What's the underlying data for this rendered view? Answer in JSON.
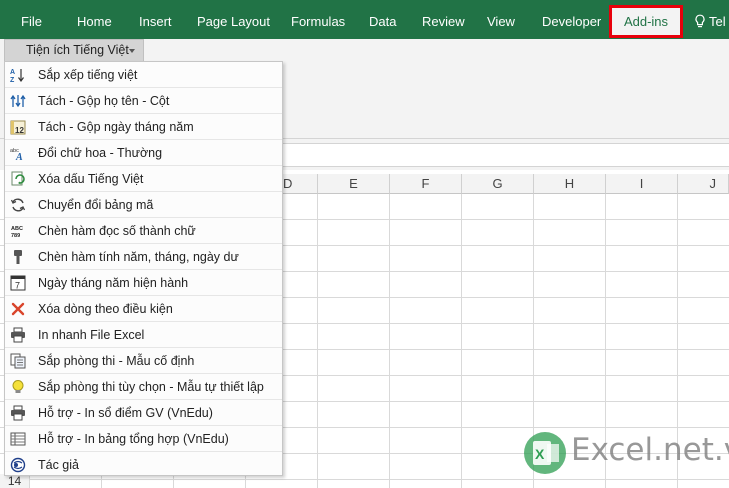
{
  "ribbon_tabs": [
    {
      "label": "File"
    },
    {
      "label": "Home"
    },
    {
      "label": "Insert"
    },
    {
      "label": "Page Layout"
    },
    {
      "label": "Formulas"
    },
    {
      "label": "Data"
    },
    {
      "label": "Review"
    },
    {
      "label": "View"
    },
    {
      "label": "Developer"
    }
  ],
  "active_tab": {
    "label": "Add-ins"
  },
  "tell_me": {
    "label": "Tel",
    "icon": "lightbulb-icon"
  },
  "addin_dropdown": {
    "label": "Tiện ích Tiếng Việt"
  },
  "columns": [
    "D",
    "E",
    "F",
    "G",
    "H",
    "I",
    "J"
  ],
  "row_label": "14",
  "menu_items": [
    {
      "label": "Sắp xếp tiếng việt",
      "icon": "sort-az-icon"
    },
    {
      "label": "Tách - Gộp họ tên - Cột",
      "icon": "split-merge-icon"
    },
    {
      "label": "Tách - Gộp ngày tháng năm",
      "icon": "calendar-split-icon"
    },
    {
      "label": "Đổi chữ hoa - Thường",
      "icon": "change-case-icon"
    },
    {
      "label": "Xóa dấu Tiếng Việt",
      "icon": "remove-accent-icon"
    },
    {
      "label": "Chuyển đổi bảng mã",
      "icon": "convert-icon"
    },
    {
      "label": "Chèn hàm đọc số thành chữ",
      "icon": "number-to-text-icon"
    },
    {
      "label": "Chèn hàm tính năm, tháng, ngày dư",
      "icon": "pin-icon"
    },
    {
      "label": "Ngày tháng năm hiện hành",
      "icon": "calendar-icon"
    },
    {
      "label": "Xóa dòng theo điều kiện",
      "icon": "delete-x-icon"
    },
    {
      "label": "In nhanh File Excel",
      "icon": "printer-icon"
    },
    {
      "label": "Sắp phòng thi - Mẫu cố định",
      "icon": "copy-pages-icon"
    },
    {
      "label": "Sắp phòng thi tùy chọn - Mẫu tự thiết lập",
      "icon": "lightbulb-icon"
    },
    {
      "label": "Hỗ trợ - In sổ điểm GV (VnEdu)",
      "icon": "printer-icon"
    },
    {
      "label": "Hỗ trợ - In bảng tổng hợp (VnEdu)",
      "icon": "table-list-icon"
    },
    {
      "label": "Tác giả",
      "icon": "author-globe-icon"
    }
  ],
  "watermark": {
    "text": "Excel.net.vn",
    "logo_letter": "X"
  },
  "colors": {
    "ribbon_green": "#217346",
    "highlight_red": "#e8000b"
  }
}
